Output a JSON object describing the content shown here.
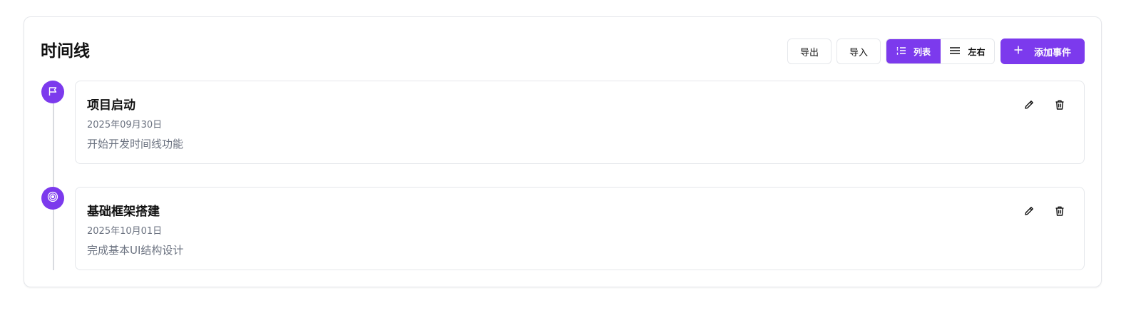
{
  "header": {
    "title": "时间线",
    "export_label": "导出",
    "import_label": "导入",
    "view_list_label": "列表",
    "view_split_label": "左右",
    "add_label": "添加事件"
  },
  "events": [
    {
      "title": "项目启动",
      "date": "2025年09月30日",
      "description": "开始开发时间线功能",
      "icon": "flag-icon"
    },
    {
      "title": "基础框架搭建",
      "date": "2025年10月01日",
      "description": "完成基本UI结构设计",
      "icon": "target-icon"
    }
  ],
  "colors": {
    "accent": "#7c3aed",
    "border": "#e5e7eb",
    "muted_text": "#6b7280"
  }
}
